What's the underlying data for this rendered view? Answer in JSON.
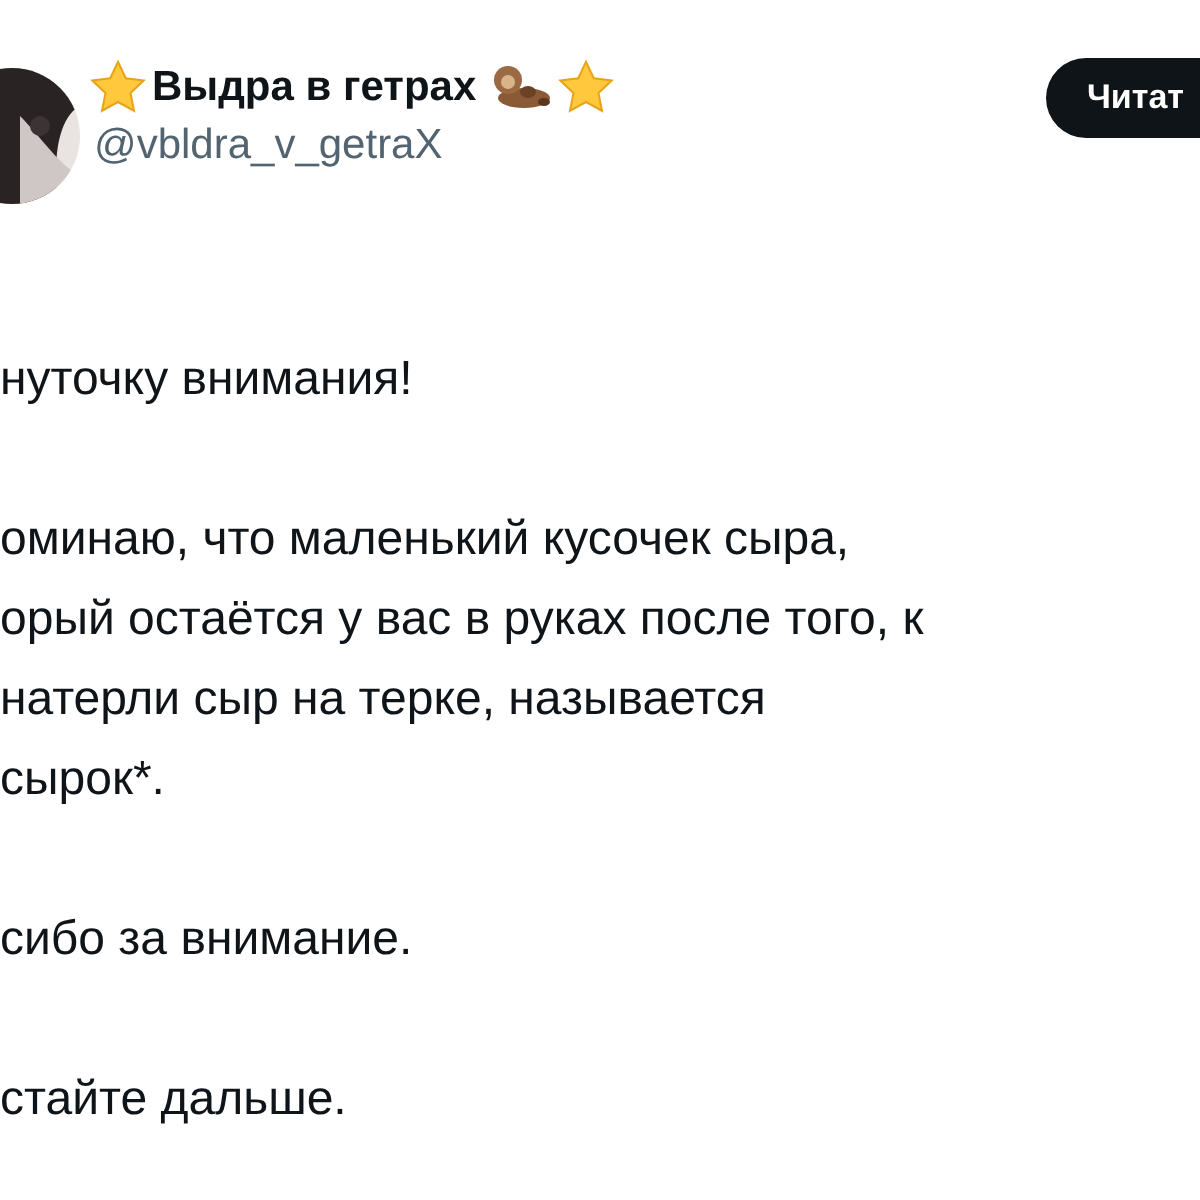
{
  "author": {
    "name": "Выдра в гетрах",
    "handle": "@vbldra_v_getraX"
  },
  "follow_button": "Читат",
  "paragraphs": [
    [
      "нуточку внимания!"
    ],
    [
      "оминаю, что маленький кусочек сыра,",
      "орый остаётся у вас в руках после того, к",
      "натерли сыр на терке, называется",
      "сырок*."
    ],
    [
      "сибо за внимание."
    ],
    [
      "стайте дальше."
    ]
  ]
}
